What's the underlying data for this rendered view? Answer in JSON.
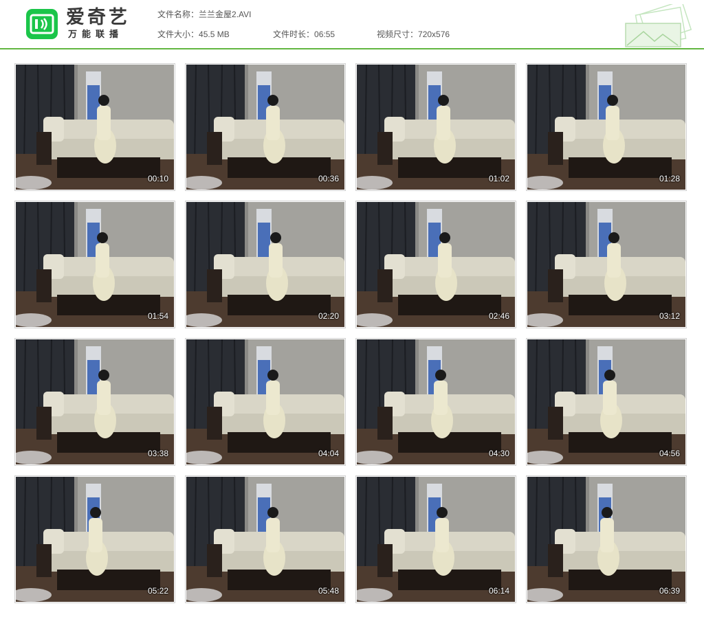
{
  "app": {
    "brand": "爱奇艺",
    "tagline": "万能联播",
    "brand_color": "#1bc54a"
  },
  "file_info": {
    "name_label": "文件名称：",
    "name_value": "兰兰金屋2.AVI",
    "size_label": "文件大小：",
    "size_value": "45.5 MB",
    "duration_label": "文件时长：",
    "duration_value": "06:55",
    "resolution_label": "视频尺寸：",
    "resolution_value": "720x576"
  },
  "accent_color": "#61b63f",
  "thumbnails": [
    {
      "time": "00:10"
    },
    {
      "time": "00:36"
    },
    {
      "time": "01:02"
    },
    {
      "time": "01:28"
    },
    {
      "time": "01:54"
    },
    {
      "time": "02:20"
    },
    {
      "time": "02:46"
    },
    {
      "time": "03:12"
    },
    {
      "time": "03:38"
    },
    {
      "time": "04:04"
    },
    {
      "time": "04:30"
    },
    {
      "time": "04:56"
    },
    {
      "time": "05:22"
    },
    {
      "time": "05:48"
    },
    {
      "time": "06:14"
    },
    {
      "time": "06:39"
    }
  ]
}
